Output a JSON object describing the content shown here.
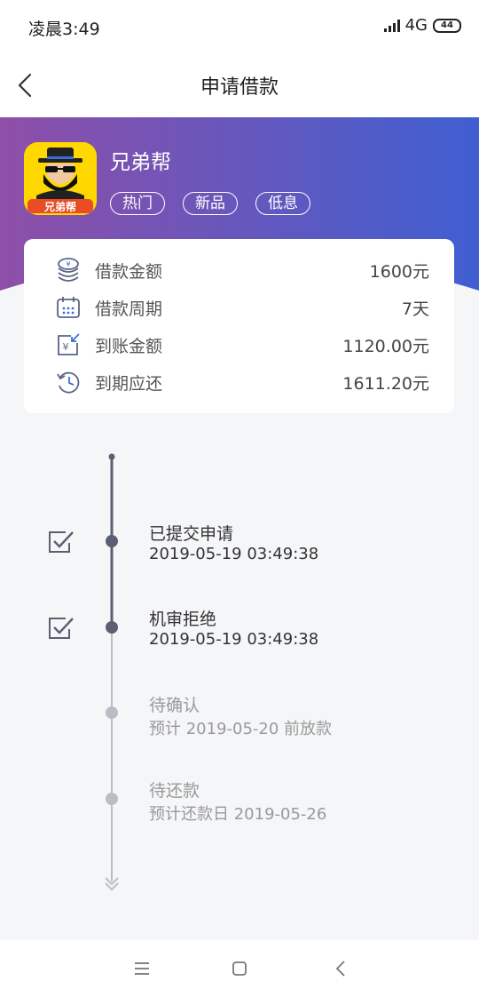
{
  "status": {
    "time": "凌晨3:49",
    "network": "4G",
    "battery": "44"
  },
  "nav": {
    "title": "申请借款"
  },
  "product": {
    "name": "兄弟帮",
    "logo_text": "兄弟帮",
    "tags": [
      "热门",
      "新品",
      "低息"
    ]
  },
  "loan": {
    "rows": [
      {
        "icon": "coins-icon",
        "label": "借款金额",
        "value": "1600元"
      },
      {
        "icon": "calendar-icon",
        "label": "借款周期",
        "value": "7天"
      },
      {
        "icon": "arrival-icon",
        "label": "到账金额",
        "value": "1120.00元"
      },
      {
        "icon": "clock-return-icon",
        "label": "到期应还",
        "value": "1611.20元"
      }
    ]
  },
  "timeline": [
    {
      "title": "已提交申请",
      "sub": "2019-05-19 03:49:38",
      "done": true
    },
    {
      "title": "机审拒绝",
      "sub": "2019-05-19 03:49:38",
      "done": true
    },
    {
      "title": "待确认",
      "sub": "预计 2019-05-20 前放款",
      "done": false
    },
    {
      "title": "待还款",
      "sub": "预计还款日 2019-05-26",
      "done": false
    }
  ],
  "colors": {
    "gradient_start": "#8e4fa8",
    "gradient_end": "#3f5fd1",
    "done": "#5a6072",
    "pending": "#bbbdc4"
  }
}
